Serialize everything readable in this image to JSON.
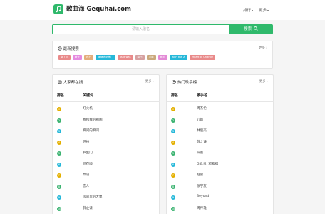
{
  "header": {
    "brand": "歌曲海 Gequhai.com",
    "nav": [
      {
        "label": "排行",
        "caret": "▾"
      },
      {
        "label": "更多",
        "caret": "▾"
      }
    ]
  },
  "search": {
    "placeholder": "请输入歌名",
    "button_label": "搜索",
    "button_icon": "search-icon"
  },
  "recent": {
    "title": "最新搜索",
    "more": "更多 ›",
    "tags": [
      {
        "label": "翻了你",
        "color": "#e98a8a"
      },
      {
        "label": "晴天",
        "color": "#e58be0"
      },
      {
        "label": "昨日",
        "color": "#e3ad7c"
      },
      {
        "label": "情绪大品牌门",
        "color": "#26b8d9"
      },
      {
        "label": "as it was",
        "color": "#e98a8a"
      },
      {
        "label": "春日",
        "color": "#d6a0a0"
      },
      {
        "label": "手纸",
        "color": "#caa87b"
      },
      {
        "label": "暗恋",
        "color": "#e38ad6"
      },
      {
        "label": "with the 名",
        "color": "#26b8d9"
      },
      {
        "label": "Heart of Change",
        "color": "#e98a8a"
      }
    ]
  },
  "hot_search": {
    "title": "大家都在搜",
    "more": "更多 ›",
    "col_rank": "排名",
    "col_name": "关键词",
    "rows": [
      {
        "rank": "1",
        "name": "灯火机",
        "color": "#e4b000"
      },
      {
        "rank": "2",
        "name": "我和我的祖国",
        "color": "#3cb371"
      },
      {
        "rank": "3",
        "name": "瞬间的瞬间",
        "color": "#26b8d9"
      },
      {
        "rank": "4",
        "name": "泪桥",
        "color": "#e4b000"
      },
      {
        "rank": "5",
        "name": "罗生门",
        "color": "#3cb371"
      },
      {
        "rank": "6",
        "name": "同花顺",
        "color": "#26b8d9"
      },
      {
        "rank": "7",
        "name": "桦语",
        "color": "#e4b000"
      },
      {
        "rank": "8",
        "name": "恋人",
        "color": "#3cb371"
      },
      {
        "rank": "9",
        "name": "房间里的大象",
        "color": "#26b8d9"
      },
      {
        "rank": "10",
        "name": "薛之谦",
        "color": "#3cb371"
      }
    ]
  },
  "hot_singers": {
    "title": "热门歌手榜",
    "more": "更多 ›",
    "col_rank": "排名",
    "col_name": "歌手名",
    "rows": [
      {
        "rank": "1",
        "name": "周杰伦",
        "color": "#e4b000"
      },
      {
        "rank": "2",
        "name": "刀郎",
        "color": "#3cb371"
      },
      {
        "rank": "3",
        "name": "林俊杰",
        "color": "#26b8d9"
      },
      {
        "rank": "4",
        "name": "薛之谦",
        "color": "#e4b000"
      },
      {
        "rank": "5",
        "name": "许嵩",
        "color": "#3cb371"
      },
      {
        "rank": "6",
        "name": "G.E.M. 邓紫棋",
        "color": "#26b8d9"
      },
      {
        "rank": "7",
        "name": "赵雷",
        "color": "#e4b000"
      },
      {
        "rank": "8",
        "name": "张学友",
        "color": "#3cb371"
      },
      {
        "rank": "9",
        "name": "Beyond",
        "color": "#26b8d9"
      },
      {
        "rank": "10",
        "name": "周传雄",
        "color": "#3cb371"
      }
    ]
  }
}
